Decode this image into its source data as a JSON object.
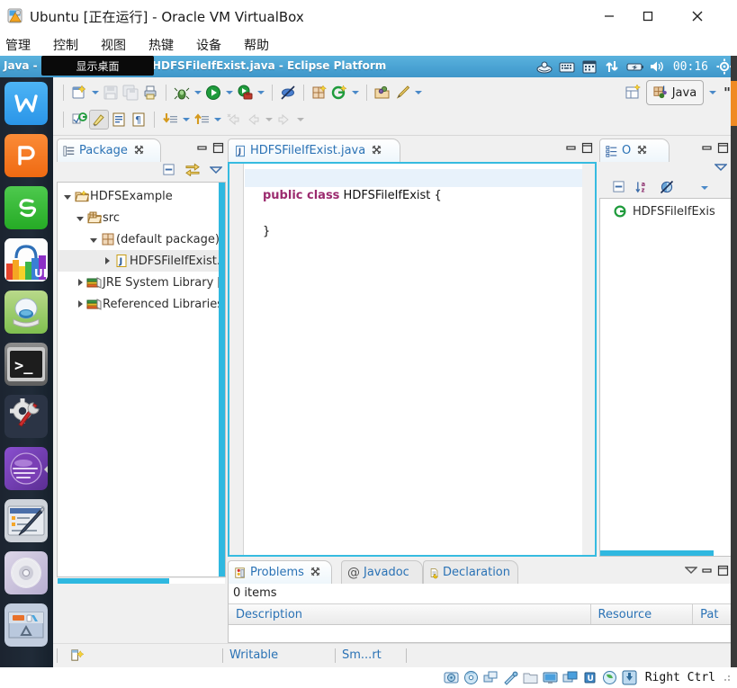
{
  "vbox": {
    "title": "Ubuntu [正在运行] - Oracle VM VirtualBox",
    "window_buttons": {
      "minimize": "minimize-button",
      "maximize": "maximize-button",
      "close": "close-button"
    },
    "menu": [
      "管理",
      "控制",
      "视图",
      "热键",
      "设备",
      "帮助"
    ],
    "statusbar": {
      "icons": [
        "hard-disk-icon",
        "optical-disk-icon",
        "network-icon",
        "usb-icon",
        "shared-folder-icon",
        "display-icon",
        "remote-display-icon",
        "cpu-icon",
        "virtualization-icon",
        "mouse-capture-icon"
      ],
      "host_key": "Right Ctrl"
    }
  },
  "ubuntu": {
    "panel": {
      "window_title": "Java - HDFSExample/src/HDFSFileIfExist.java - Eclipse Platform",
      "clock": "00:16",
      "tray_icons": [
        "ubuntu-one-icon",
        "keyboard-indicator-icon",
        "calendar-icon",
        "network-transfer-icon",
        "battery-icon",
        "volume-icon"
      ],
      "session_icon": "session-gear-icon"
    },
    "tooltip": {
      "text": "显示桌面"
    },
    "launcher": [
      {
        "name": "wps-writer-icon",
        "label": "W",
        "color": "#3ba7ef"
      },
      {
        "name": "wps-presentation-icon",
        "label": "P",
        "color": "#f47523"
      },
      {
        "name": "wps-spreadsheet-icon",
        "label": "S",
        "color": "#2eb82e"
      },
      {
        "name": "ubuntu-software-center-icon",
        "label": "UK",
        "color": "#ffffff"
      },
      {
        "name": "help-icon",
        "label": "",
        "color": "#7fbf4f"
      },
      {
        "name": "terminal-icon",
        "label": ">_",
        "color": "#2c2c2c"
      },
      {
        "name": "system-settings-icon",
        "label": "",
        "color": "#35405a"
      },
      {
        "name": "eclipse-icon",
        "label": "",
        "color": "#6b3fa0",
        "active": true
      },
      {
        "name": "gedit-icon",
        "label": "",
        "color": "#c9cbd3"
      },
      {
        "name": "disc-burner-icon",
        "label": "",
        "color": "#c6bfd6"
      },
      {
        "name": "trash-icon",
        "label": "",
        "color": "#b9c6d8"
      }
    ]
  },
  "eclipse": {
    "toolbar": {
      "row1": [
        {
          "name": "new-wizard-button",
          "icon": "new-file-icon"
        },
        {
          "name": "new-dropdown",
          "icon": "chevron-down-icon"
        },
        {
          "name": "save-button",
          "icon": "save-icon",
          "disabled": true
        },
        {
          "name": "save-all-button",
          "icon": "save-all-icon",
          "disabled": true
        },
        {
          "name": "print-button",
          "icon": "print-icon"
        },
        {
          "name": "debug-button",
          "icon": "debug-bug-icon"
        },
        {
          "name": "debug-dropdown",
          "icon": "chevron-down-icon"
        },
        {
          "name": "run-button",
          "icon": "run-play-icon"
        },
        {
          "name": "run-dropdown",
          "icon": "chevron-down-icon"
        },
        {
          "name": "run-external-tools-button",
          "icon": "external-tools-icon"
        },
        {
          "name": "external-tools-dropdown",
          "icon": "chevron-down-icon"
        },
        {
          "name": "skip-breakpoints-button",
          "icon": "skip-breakpoints-icon"
        },
        {
          "name": "new-java-package-button",
          "icon": "package-icon"
        },
        {
          "name": "new-java-class-button",
          "icon": "new-class-icon"
        },
        {
          "name": "new-class-dropdown",
          "icon": "chevron-down-icon"
        },
        {
          "name": "open-type-button",
          "icon": "open-type-icon"
        },
        {
          "name": "search-button",
          "icon": "search-pencil-icon"
        },
        {
          "name": "search-dropdown",
          "icon": "chevron-down-icon"
        }
      ],
      "row2": [
        {
          "name": "next-annotation-button",
          "icon": "next-annotation-icon"
        },
        {
          "name": "toggle-mark-occurrences-button",
          "icon": "mark-occurrences-icon",
          "active": true
        },
        {
          "name": "show-whitespace-button",
          "icon": "whitespace-icon"
        },
        {
          "name": "toggle-block-selection-button",
          "icon": "block-selection-icon"
        },
        {
          "name": "next-edit-location-button",
          "icon": "down-arrow-icon"
        },
        {
          "name": "next-dropdown",
          "icon": "chevron-down-icon"
        },
        {
          "name": "previous-edit-location-button",
          "icon": "up-arrow-icon"
        },
        {
          "name": "previous-dropdown",
          "icon": "chevron-down-icon"
        },
        {
          "name": "last-edit-location-button",
          "icon": "last-edit-icon",
          "disabled": true
        },
        {
          "name": "back-button",
          "icon": "back-arrow-icon",
          "disabled": true
        },
        {
          "name": "back-dropdown",
          "icon": "chevron-down-icon",
          "disabled": true
        },
        {
          "name": "forward-button",
          "icon": "forward-arrow-icon",
          "disabled": true
        },
        {
          "name": "forward-dropdown",
          "icon": "chevron-down-icon",
          "disabled": true
        }
      ],
      "overflow_label": "\"",
      "open-perspective-name": "open-perspective-button",
      "perspective_label": "Java"
    },
    "package_explorer": {
      "tab_label": "Package",
      "tab_icon": "package-explorer-icon",
      "close_icon": "close-icon",
      "minimize_icon": "minimize-icon",
      "maximize_icon": "maximize-icon",
      "toolbar": [
        {
          "name": "collapse-all-button",
          "icon": "collapse-all-icon"
        },
        {
          "name": "link-with-editor-button",
          "icon": "link-editor-icon"
        },
        {
          "name": "view-menu-button",
          "icon": "view-menu-icon"
        }
      ],
      "tree": [
        {
          "label": "HDFSExample",
          "indent": 0,
          "twisty": "expanded",
          "icon": "java-project-icon",
          "selected": false
        },
        {
          "label": "src",
          "indent": 1,
          "twisty": "expanded",
          "icon": "source-folder-icon",
          "selected": false
        },
        {
          "label": "(default package)",
          "indent": 2,
          "twisty": "expanded",
          "icon": "package-icon",
          "selected": false
        },
        {
          "label": "HDFSFileIfExist.j",
          "indent": 3,
          "twisty": "collapsed",
          "icon": "java-file-icon",
          "selected": true
        },
        {
          "label": "JRE System Library [",
          "indent": 1,
          "twisty": "collapsed",
          "icon": "library-icon",
          "selected": false
        },
        {
          "label": "Referenced Libraries",
          "indent": 1,
          "twisty": "collapsed",
          "icon": "library-icon",
          "selected": false
        }
      ]
    },
    "editor": {
      "tab_label": "HDFSFileIfExist.java",
      "tab_icon": "java-file-icon",
      "close_icon": "close-icon",
      "minimize_icon": "minimize-icon",
      "maximize_icon": "maximize-icon",
      "code_lines": [
        {
          "text": "",
          "cursor": true,
          "keyword": ""
        },
        {
          "text": " HDFSFileIfExist {",
          "cursor": false,
          "keyword": "public class"
        },
        {
          "text": "",
          "cursor": false,
          "keyword": ""
        },
        {
          "text": "}",
          "cursor": false,
          "keyword": ""
        }
      ]
    },
    "outline": {
      "tab_label": "O",
      "tab_icon": "outline-icon",
      "close_icon": "close-icon",
      "minimize_icon": "minimize-icon",
      "maximize_icon": "maximize-icon",
      "view_menu_icon": "view-menu-icon",
      "toolbar": [
        {
          "name": "collapse-all-button",
          "icon": "collapse-all-icon"
        },
        {
          "name": "sort-button",
          "icon": "sort-az-icon"
        },
        {
          "name": "hide-fields-button",
          "icon": "hide-fields-icon"
        },
        {
          "name": "outline-menu-button",
          "icon": "chevron-down-icon"
        }
      ],
      "items": [
        {
          "label": "HDFSFileIfExis",
          "icon": "class-icon"
        }
      ]
    },
    "bottom_panel": {
      "tabs": [
        {
          "label": "Problems",
          "icon": "problems-icon",
          "active": true,
          "closeable": true
        },
        {
          "label": "Javadoc",
          "icon": "javadoc-at-icon",
          "active": false,
          "closeable": false
        },
        {
          "label": "Declaration",
          "icon": "declaration-icon",
          "active": false,
          "closeable": false
        }
      ],
      "view_menu_icon": "view-menu-icon",
      "minimize_icon": "minimize-icon",
      "maximize_icon": "maximize-icon",
      "item_count": "0 items",
      "columns": [
        "Description",
        "Resource",
        "Pat"
      ]
    },
    "status_bar": {
      "lock_icon": "editor-state-icon",
      "writable": "Writable",
      "insert_mode": "Sm...rt"
    }
  }
}
